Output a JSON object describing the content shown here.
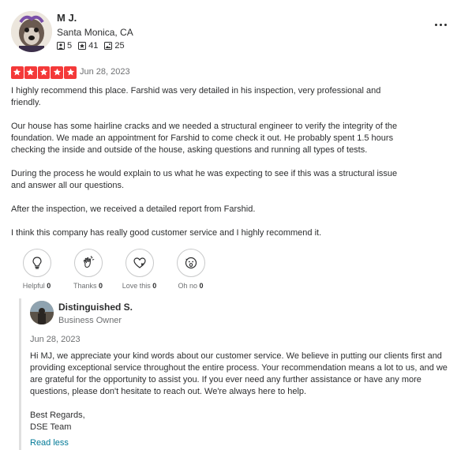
{
  "reviewer": {
    "name": "M J.",
    "location": "Santa Monica, CA",
    "stats": [
      {
        "icon": "friends-icon",
        "value": "5"
      },
      {
        "icon": "reviews-icon",
        "value": "41"
      },
      {
        "icon": "photos-icon",
        "value": "25"
      }
    ]
  },
  "review": {
    "rating": 5,
    "rating_max": 5,
    "date": "Jun 28, 2023",
    "paragraphs": [
      "I highly recommend this place. Farshid was very detailed in his inspection, very professional and friendly.",
      "Our house has some hairline cracks and we needed a structural engineer to verify the integrity of the foundation. We made an appointment for Farshid to come check it out. He probably spent 1.5 hours checking the inside and outside of the house, asking questions and running all types of tests.",
      "During the process he would explain to us what he was expecting to see if this was a structural issue and answer all our questions.",
      "After the inspection, we received a detailed report from Farshid.",
      "I think this company has really good customer service and I highly recommend it."
    ]
  },
  "reactions": [
    {
      "label": "Helpful",
      "count": "0",
      "icon": "lightbulb-icon"
    },
    {
      "label": "Thanks",
      "count": "0",
      "icon": "clapping-hands-icon"
    },
    {
      "label": "Love this",
      "count": "0",
      "icon": "heart-icon"
    },
    {
      "label": "Oh no",
      "count": "0",
      "icon": "shocked-face-icon"
    }
  ],
  "owner_reply": {
    "name": "Distinguished S.",
    "role": "Business Owner",
    "date": "Jun 28, 2023",
    "paragraphs": [
      "Hi MJ, we appreciate your kind words about our customer service. We believe in putting our clients first and providing exceptional service throughout the entire process. Your recommendation means a lot to us, and we are grateful for the opportunity to assist you. If you ever need any further assistance or have any more questions, please don't hesitate to reach out. We're always here to help.",
      "Best Regards,\nDSE Team"
    ],
    "read_less": "Read less"
  },
  "colors": {
    "star_red": "#f43939",
    "link_teal": "#027a97"
  }
}
